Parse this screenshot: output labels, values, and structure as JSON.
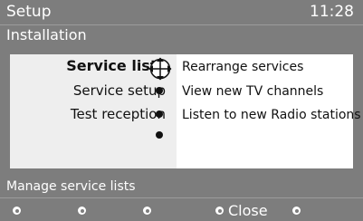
{
  "header": {
    "title": "Setup",
    "time": "11:28",
    "subtitle": "Installation"
  },
  "menu": {
    "items": [
      {
        "label": "Service lists",
        "selected": true
      },
      {
        "label": "Service setup",
        "selected": false
      },
      {
        "label": "Test reception",
        "selected": false
      },
      {
        "label": "",
        "selected": false
      }
    ]
  },
  "submenu": {
    "options": [
      {
        "label": "Rearrange services"
      },
      {
        "label": "View new TV channels"
      },
      {
        "label": "Listen to new Radio stations"
      }
    ]
  },
  "status": {
    "text": "Manage service lists"
  },
  "footer": {
    "close_label": "Close"
  },
  "colors": {
    "frame": "#7d7d7d",
    "panel_left": "#eeeeee",
    "panel_right": "#ffffff",
    "text": "#111111"
  }
}
